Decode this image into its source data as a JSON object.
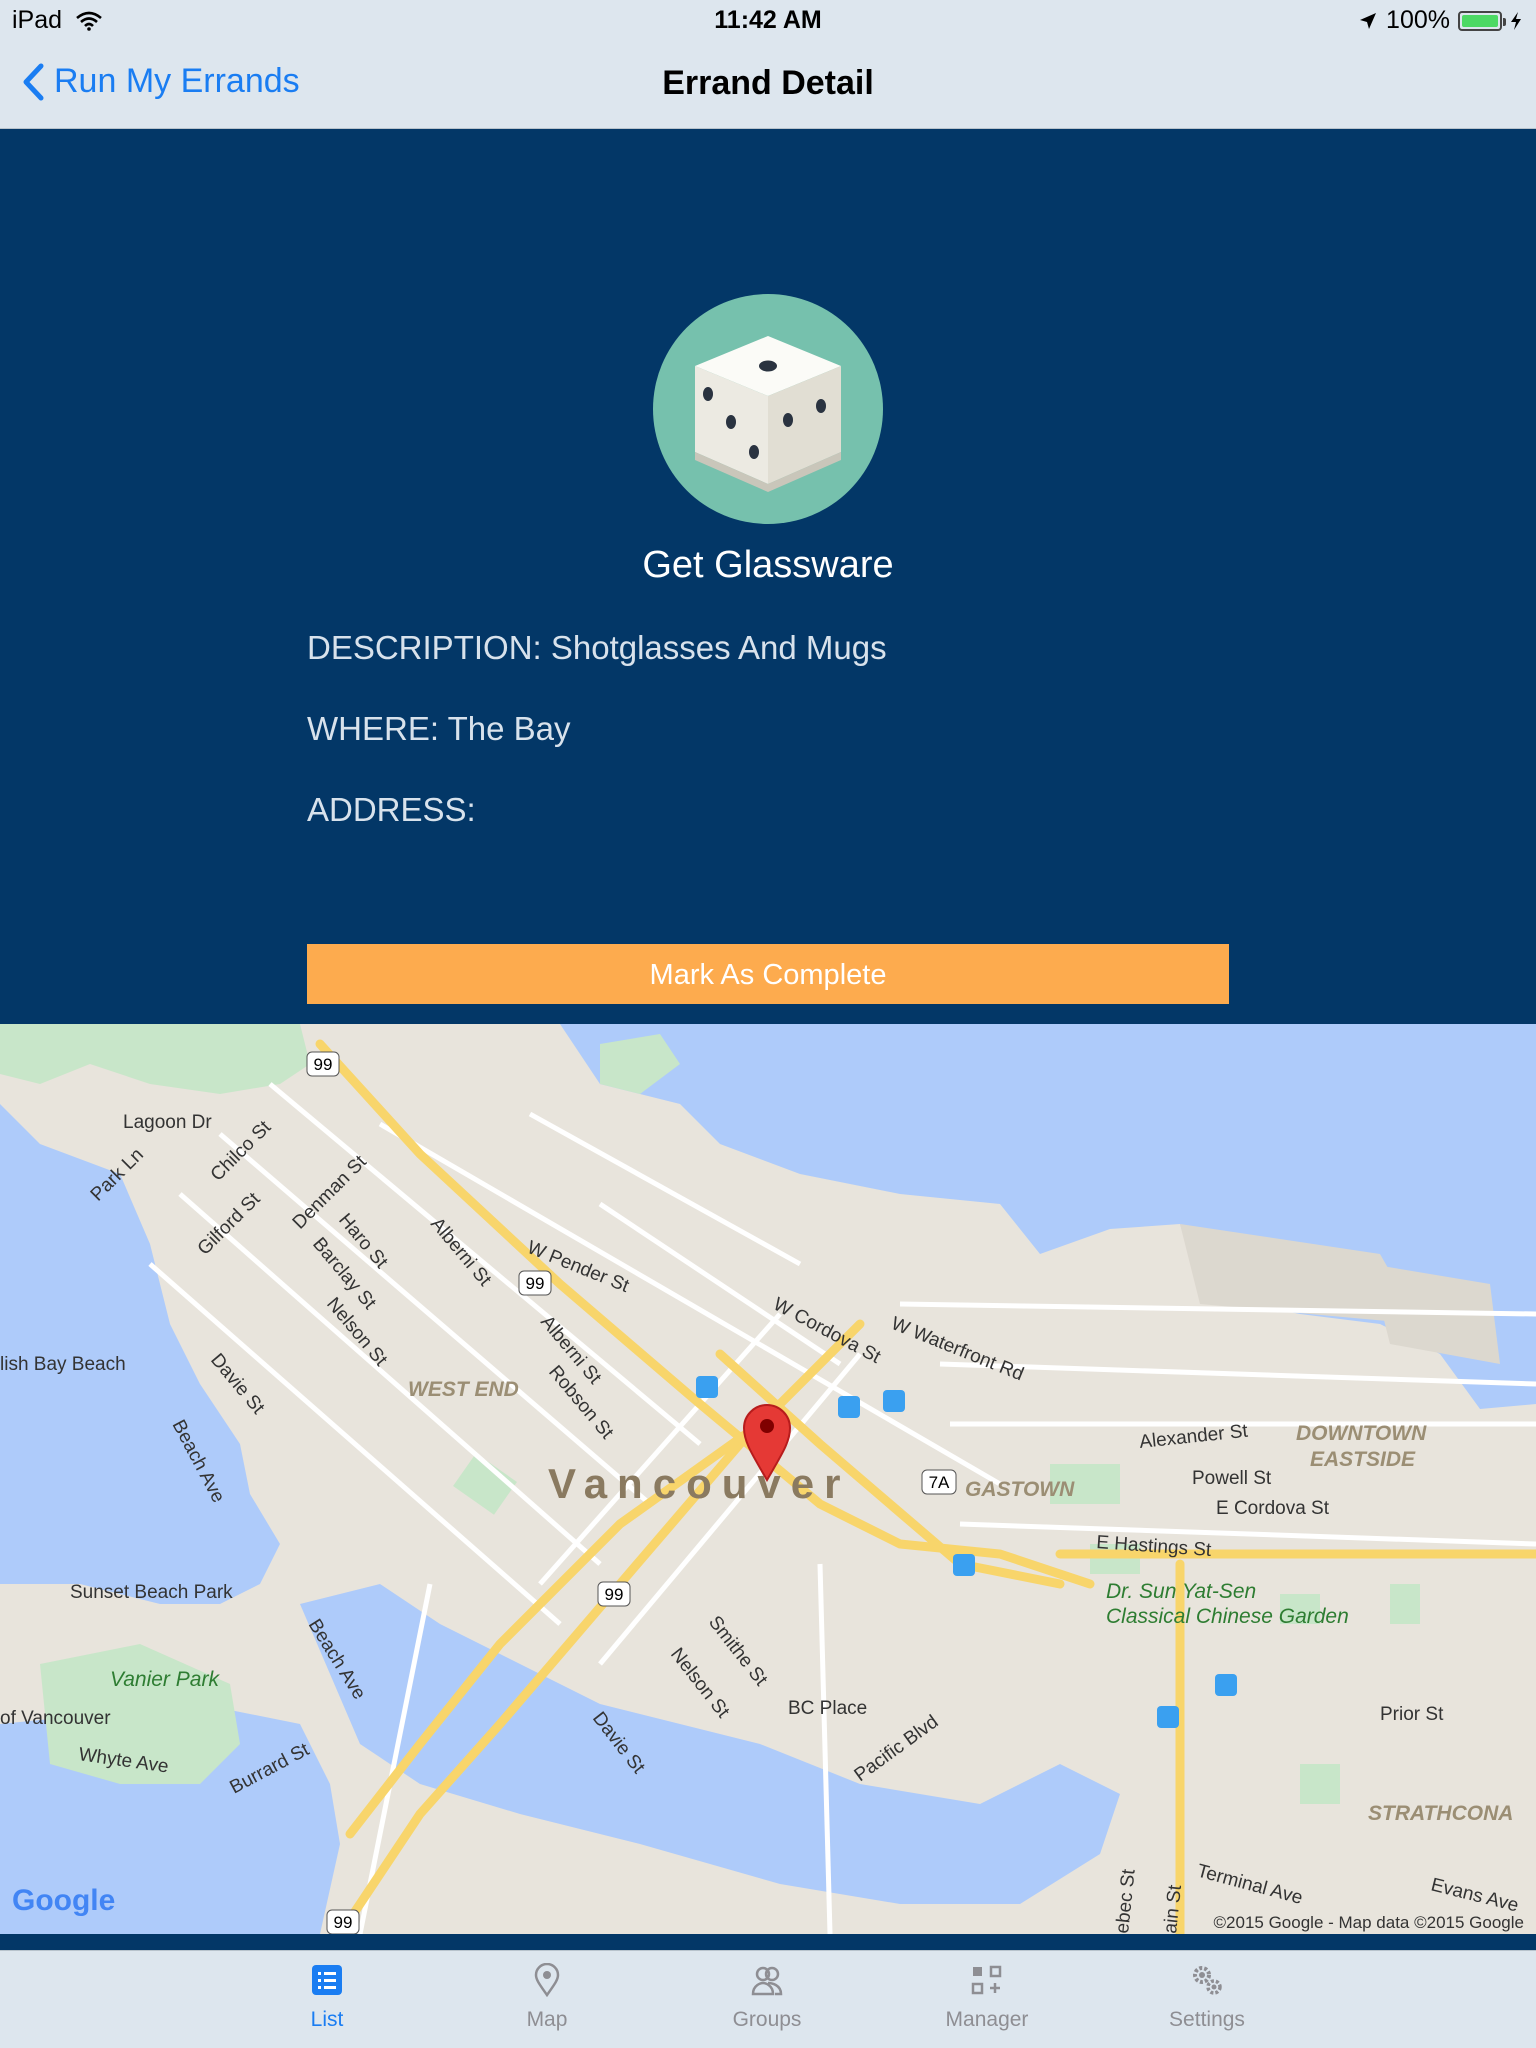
{
  "status_bar": {
    "device": "iPad",
    "time": "11:42 AM",
    "battery": "100%"
  },
  "nav": {
    "back_label": "Run My Errands",
    "title": "Errand Detail"
  },
  "errand": {
    "title": "Get Glassware",
    "description": "DESCRIPTION: Shotglasses And Mugs",
    "where": "WHERE: The Bay",
    "address": "ADDRESS:",
    "complete_label": "Mark As Complete"
  },
  "map": {
    "city_label": "Vancouver",
    "labels": {
      "lagoon_dr": "Lagoon Dr",
      "park_ln": "Park Ln",
      "chilco_st": "Chilco St",
      "gilford_st": "Gilford St",
      "denman_st": "Denman St",
      "haro_st": "Haro St",
      "barclay_st": "Barclay St",
      "nelson_st_w": "Nelson St",
      "alberni_st_1": "Alberni St",
      "alberni_st_2": "Alberni St",
      "robson_st": "Robson St",
      "w_pender_st": "W Pender St",
      "w_cordova_st": "W Cordova St",
      "w_waterfront_rd": "W Waterfront Rd",
      "west_end": "WEST END",
      "english_bay_beach": "lish Bay Beach",
      "davie_st_w": "Davie St",
      "beach_ave_1": "Beach Ave",
      "sunset_beach_park": "Sunset Beach Park",
      "beach_ave_2": "Beach Ave",
      "vanier_park": "Vanier Park",
      "of_vancouver": "of Vancouver",
      "whyte_ave": "Whyte Ave",
      "burrard_st": "Burrard St",
      "smithe_st": "Smithe St",
      "nelson_st": "Nelson St",
      "davie_st": "Davie St",
      "bc_place": "BC Place",
      "pacific_blvd": "Pacific Blvd",
      "gastown": "GASTOWN",
      "alexander_st": "Alexander St",
      "powell_st": "Powell St",
      "e_cordova_st": "E Cordova St",
      "e_hastings_st": "E Hastings St",
      "downtown": "DOWNTOWN",
      "eastside": "EASTSIDE",
      "sun_yat_sen_1": "Dr. Sun Yat-Sen",
      "sun_yat_sen_2": "Classical Chinese Garden",
      "prior_st": "Prior St",
      "strathcona": "STRATHCONA",
      "terminal_ave": "Terminal Ave",
      "evans_ave": "Evans Ave",
      "quebec_st": "ebec St",
      "main_st": "ain St",
      "shield_99_a": "99",
      "shield_99_b": "99",
      "shield_99_c": "99",
      "shield_99_d": "99",
      "shield_7a": "7A",
      "google_logo": "Google",
      "attribution": "©2015 Google - Map data ©2015 Google"
    }
  },
  "tabs": [
    {
      "label": "List",
      "icon": "list-icon",
      "active": true
    },
    {
      "label": "Map",
      "icon": "pin-icon",
      "active": false
    },
    {
      "label": "Groups",
      "icon": "groups-icon",
      "active": false
    },
    {
      "label": "Manager",
      "icon": "manager-icon",
      "active": false
    },
    {
      "label": "Settings",
      "icon": "gear-icon",
      "active": false
    }
  ],
  "colors": {
    "panel_background": "#033767",
    "accent": "#1a7df2",
    "complete_button": "#fdab4e",
    "icon_circle": "#76c1ad"
  }
}
